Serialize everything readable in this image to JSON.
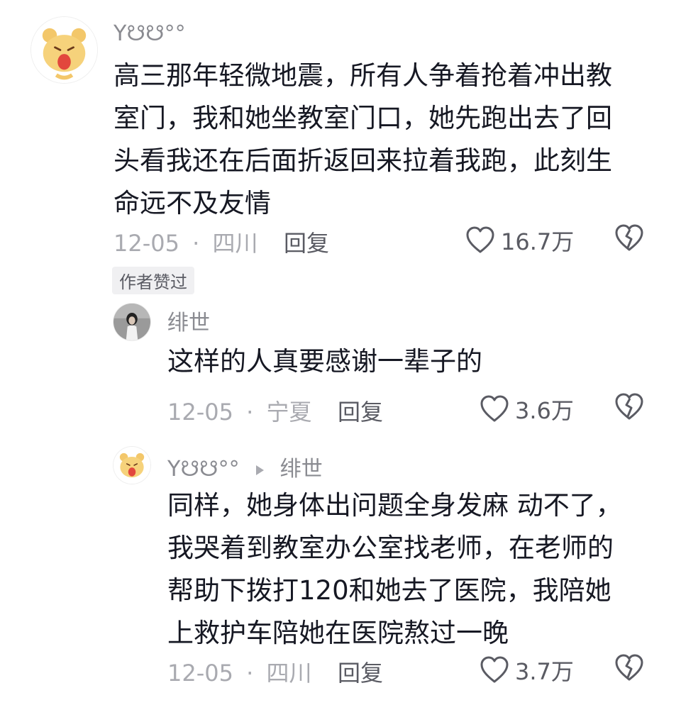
{
  "comments": [
    {
      "username": "Y☋☋°°",
      "text_lines": [
        "高三那年轻微地震，所有人争着抢着冲出教",
        "室门，我和她坐教室门口，她先跑出去了回",
        "头看我还在后面折返回来拉着我跑，此刻生",
        "命远不及友情"
      ],
      "date": "12-05",
      "location": "四川",
      "reply_label": "回复",
      "likes": "16.7万",
      "badge": "作者赞过",
      "avatar_icon": "cartoon-bear-avatar"
    },
    {
      "username": "绯世",
      "text_lines": [
        "这样的人真要感谢一辈子的"
      ],
      "date": "12-05",
      "location": "宁夏",
      "reply_label": "回复",
      "likes": "3.6万",
      "avatar_icon": "girl-photo-avatar"
    },
    {
      "username": "Y☋☋°°",
      "reply_to": "绯世",
      "text_lines": [
        "同样，她身体出问题全身发麻 动不了，",
        "我哭着到教室办公室找老师，在老师的",
        "帮助下拨打120和她去了医院，我陪她",
        "上救护车陪她在医院熬过一晚"
      ],
      "date": "12-05",
      "location": "四川",
      "reply_label": "回复",
      "likes": "3.7万",
      "avatar_icon": "cartoon-bear-avatar"
    }
  ],
  "meta_separator": "·",
  "colors": {
    "text": "#161823",
    "meta": "#a9aab0",
    "username": "#8a8b91",
    "badge_bg": "#f0f0f2"
  },
  "icons": {
    "like": "heart-outline-icon",
    "dislike": "broken-heart-icon",
    "reply_arrow": "triangle-right-icon"
  }
}
